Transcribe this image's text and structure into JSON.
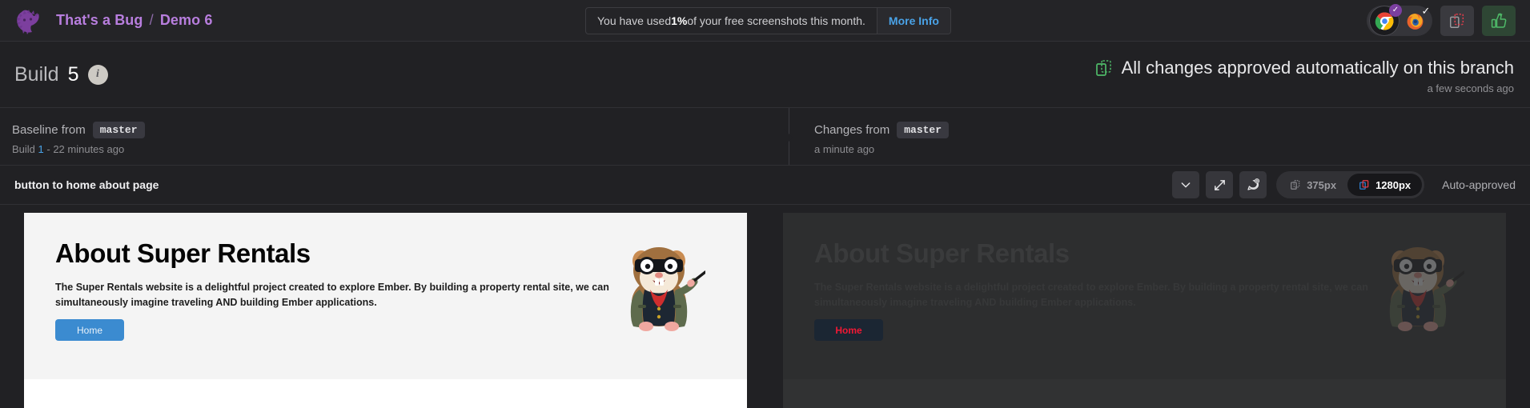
{
  "topnav": {
    "breadcrumb": {
      "org": "That's a Bug",
      "separator": "/",
      "project": "Demo 6"
    },
    "logo_icon": "percy-lion-logo",
    "usage_banner": {
      "prefix": "You have used ",
      "percent": "1%",
      "suffix": " of your free screenshots this month.",
      "more_info_label": "More Info"
    },
    "browsers": [
      {
        "name": "chrome",
        "icon": "chrome-icon",
        "active": true,
        "badge": "check",
        "badge_style": "purple"
      },
      {
        "name": "firefox",
        "icon": "firefox-icon",
        "active": false,
        "badge": "check",
        "badge_style": "plain"
      }
    ],
    "actions": [
      {
        "name": "diff-review-button",
        "icon": "diff-snapshot-icon",
        "style": "neutral"
      },
      {
        "name": "approve-all-button",
        "icon": "thumbs-up-icon",
        "style": "green"
      }
    ]
  },
  "build": {
    "label": "Build",
    "number": "5",
    "info_icon": "info-icon",
    "status_icon": "approved-diff-icon",
    "status_text": "All changes approved automatically on this branch",
    "status_time": "a few seconds ago"
  },
  "compare": {
    "baseline": {
      "label": "Baseline from",
      "branch": "master",
      "sub_prefix": "Build ",
      "sub_link": "1",
      "sub_suffix": " - 22 minutes ago"
    },
    "changes": {
      "label": "Changes from",
      "branch": "master",
      "sub": "a minute ago"
    }
  },
  "snapshot": {
    "name": "button to home about page",
    "buttons": [
      {
        "name": "collapse-button",
        "icon": "chevron-down-icon"
      },
      {
        "name": "fullscreen-button",
        "icon": "expand-arrows-icon"
      },
      {
        "name": "add-comment-button",
        "icon": "comment-plus-icon"
      }
    ],
    "widths": [
      {
        "label": "375px",
        "icon": "diff-snapshot-icon",
        "active": false
      },
      {
        "label": "1280px",
        "icon": "diff-snapshot-icon-colored",
        "active": true
      }
    ],
    "approval_status": "Auto-approved"
  },
  "rendered_page": {
    "heading": "About Super Rentals",
    "paragraph": "The Super Rentals website is a delightful project created to explore Ember. By building a property rental site, we can simultaneously imagine traveling AND building Ember applications.",
    "button_label": "Home",
    "mascot_icon": "ember-tomster-mascot"
  },
  "colors": {
    "background": "#212124",
    "topnav": "#242427",
    "brand_purple": "#b87ede",
    "link_blue": "#4aa3e8",
    "approve_green": "#5cb85c",
    "diff_red": "#f11834",
    "baseline_button_blue": "#3b8bd0"
  }
}
